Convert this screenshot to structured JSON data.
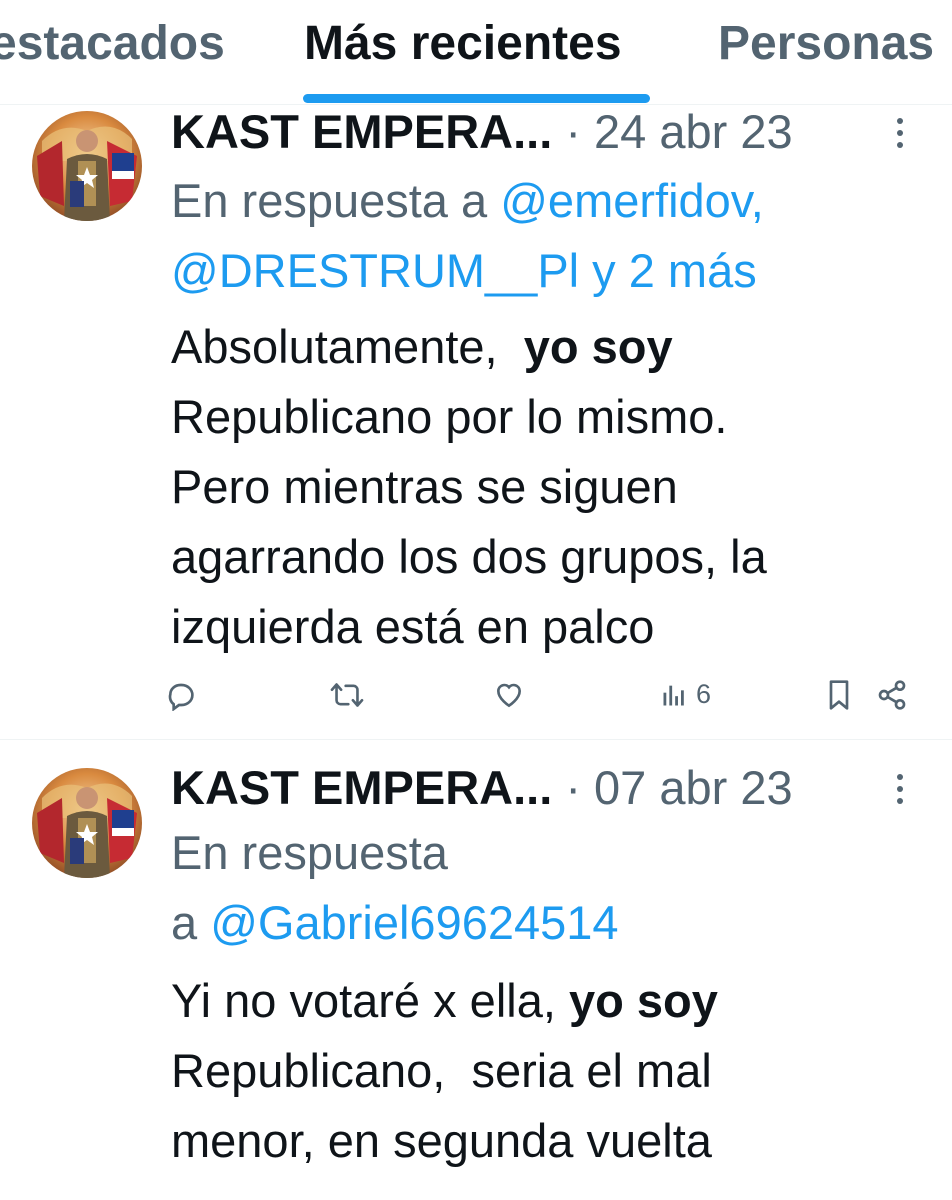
{
  "tabs": [
    {
      "label": "estacados"
    },
    {
      "label": "Más recientes",
      "active": true
    },
    {
      "label": "Personas"
    }
  ],
  "tweets": [
    {
      "author": "KAST EMPERA...",
      "dot": "·",
      "date": "24 abr 23",
      "reply_prefix": "En respuesta a",
      "mention1": "@emerfidov,",
      "mention2": "@DRESTRUM__Pl",
      "reply_and": "y 2 más",
      "text": {
        "l1_pre": "Absolutamente,",
        "l1_bold": "yo soy",
        "l2": "Republicano por lo mismo.",
        "l3": "Pero mientras se siguen",
        "l4": "agarrando los dos grupos, la",
        "l5": "izquierda está en palco"
      },
      "views": "6"
    },
    {
      "author": "KAST EMPERA...",
      "dot": "·",
      "date": "07 abr 23",
      "reply_prefix": "En respuesta",
      "reply_a": "a",
      "mention1": "@Gabriel69624514",
      "text": {
        "l1_pre": "Yi no votaré x ella,",
        "l1_bold": "yo soy",
        "l2": "Republicano,  seria el mal",
        "l3": "menor, en segunda vuelta"
      }
    }
  ],
  "colors": {
    "accent": "#1d9bf0",
    "secondary_text": "#536471",
    "primary_text": "#0f1419"
  }
}
